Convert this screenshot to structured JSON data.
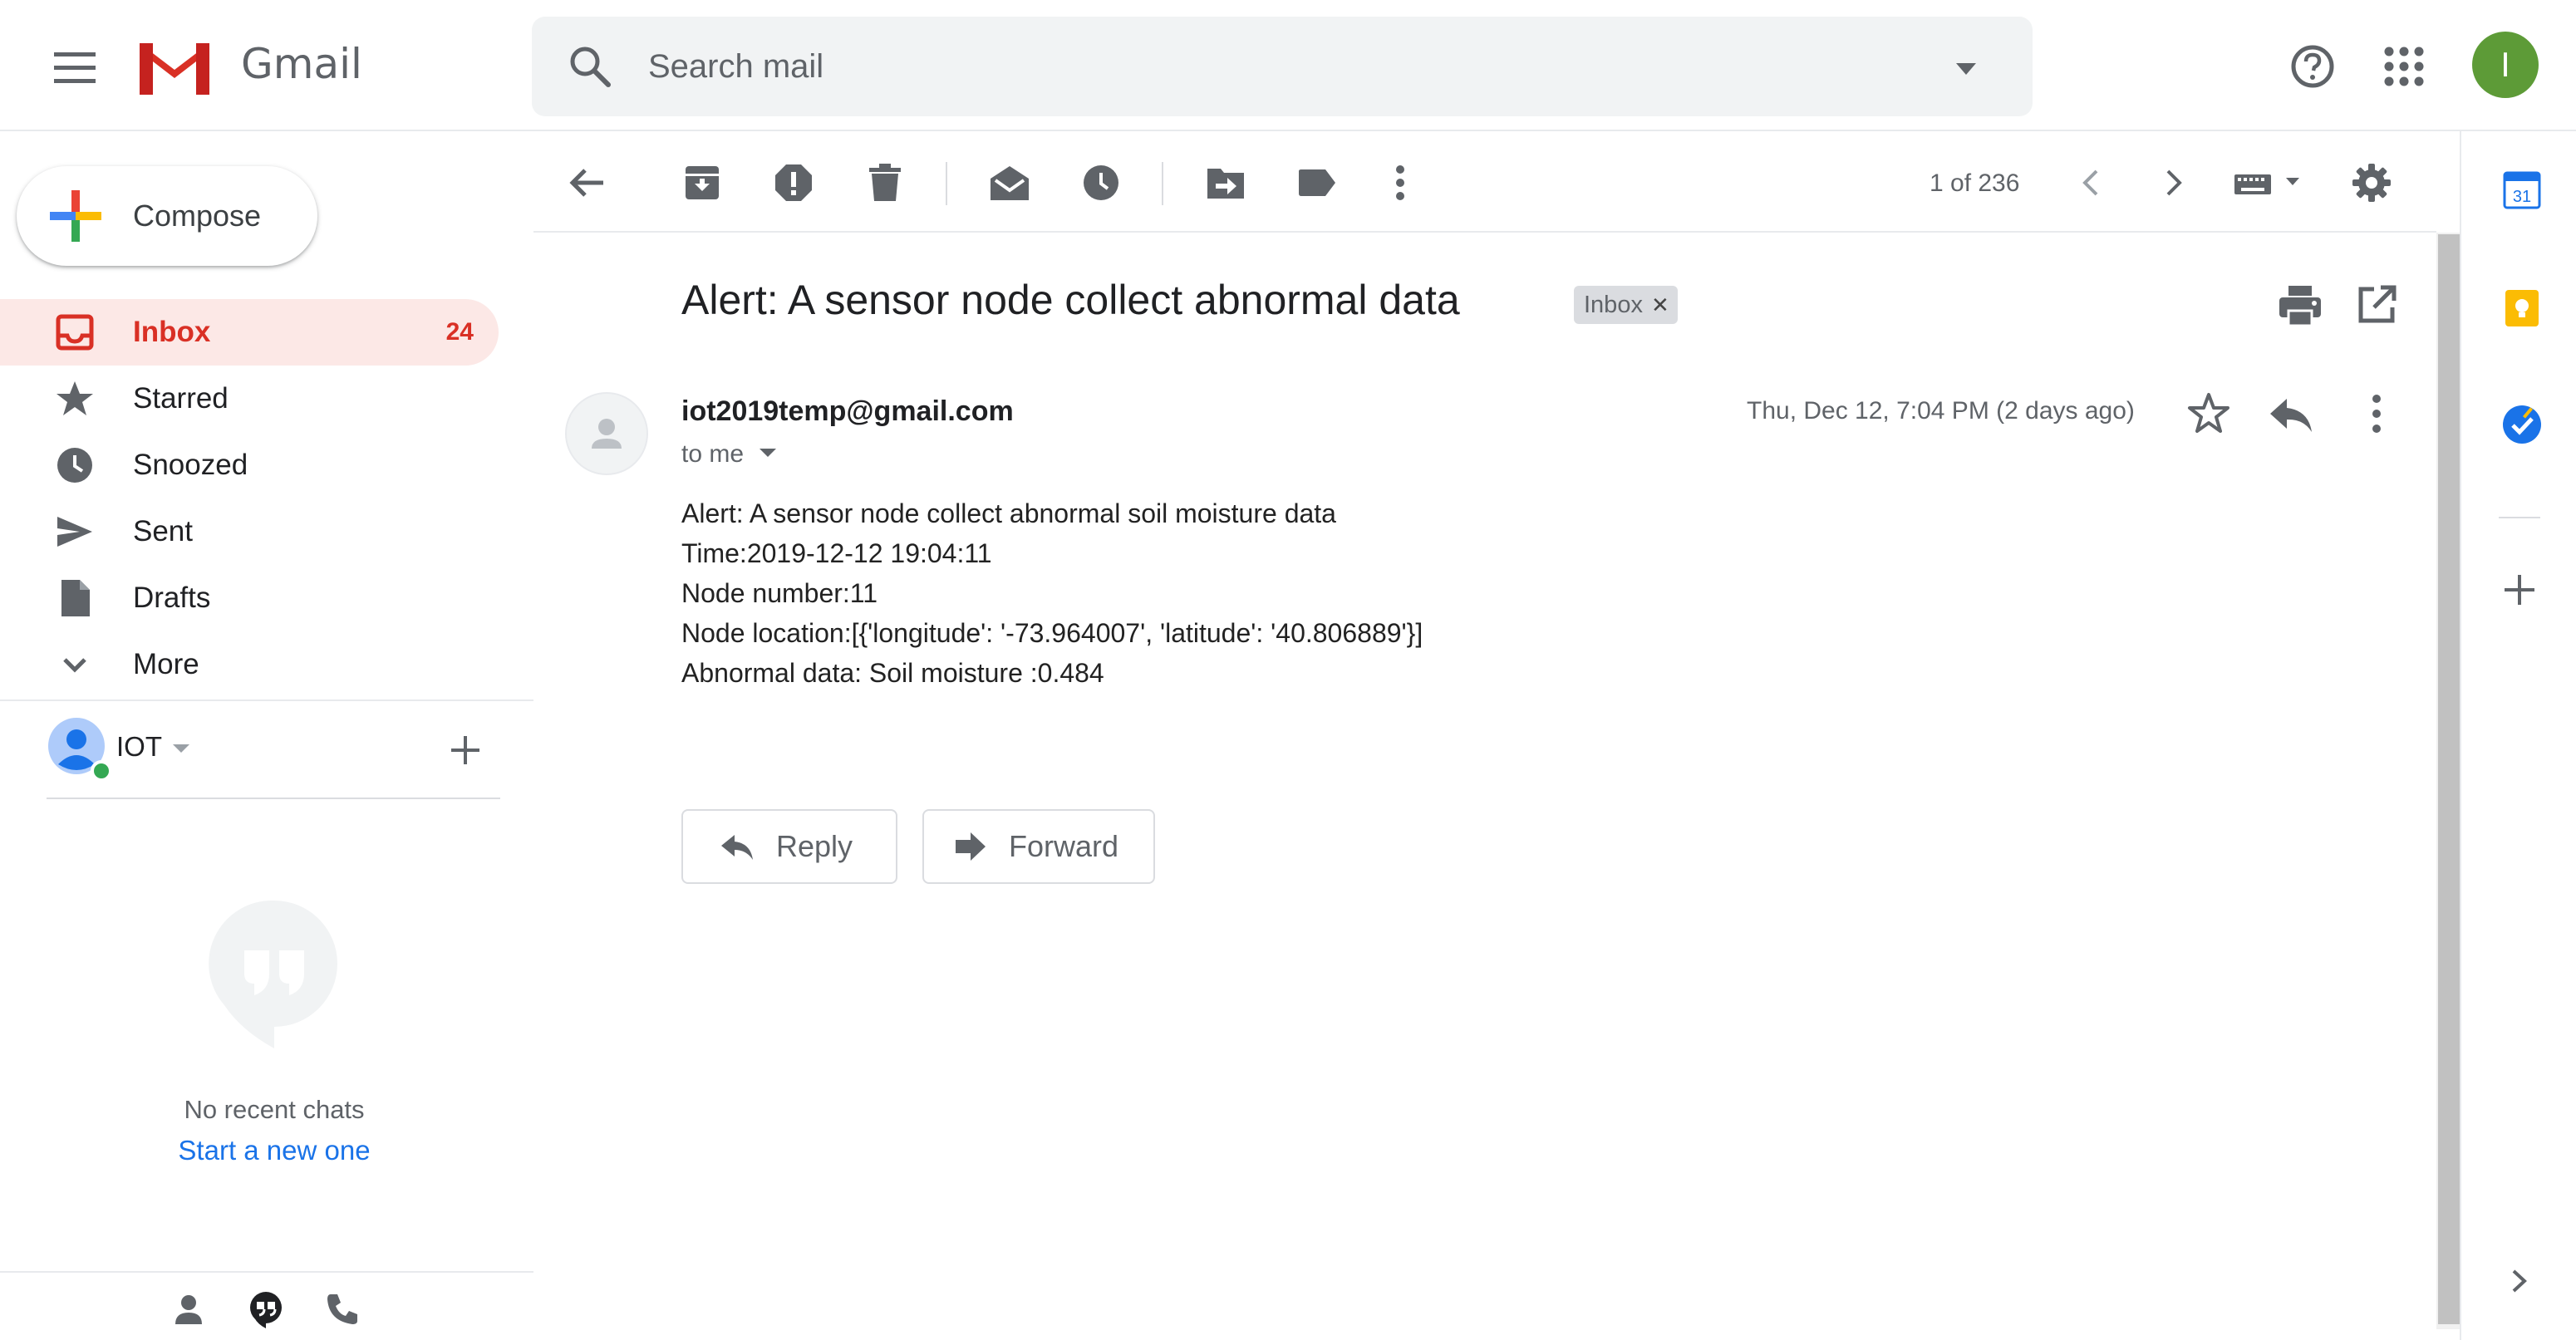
{
  "app": {
    "brand": "Gmail"
  },
  "search": {
    "placeholder": "Search mail"
  },
  "header": {
    "avatar_initial": "I"
  },
  "sidebar": {
    "compose_label": "Compose",
    "items": [
      {
        "label": "Inbox",
        "count": "24",
        "icon": "inbox-icon",
        "active": true
      },
      {
        "label": "Starred",
        "icon": "star-icon"
      },
      {
        "label": "Snoozed",
        "icon": "clock-icon"
      },
      {
        "label": "Sent",
        "icon": "send-icon"
      },
      {
        "label": "Drafts",
        "icon": "draft-icon"
      },
      {
        "label": "More",
        "icon": "chevron-down-icon"
      }
    ],
    "account_name": "IOT",
    "chat_empty": "No recent chats",
    "chat_start": "Start a new one"
  },
  "toolbar": {
    "pager": "1 of 236"
  },
  "message": {
    "subject": "Alert: A sensor node collect abnormal data",
    "label_chip": "Inbox",
    "sender": "iot2019temp@gmail.com",
    "to": "to me",
    "date": "Thu, Dec 12, 7:04 PM (2 days ago)",
    "body": [
      "Alert: A sensor node collect abnormal soil moisture data",
      "Time:2019-12-12 19:04:11",
      "Node number:11",
      "Node location:[{'longitude': '-73.964007', 'latitude': '40.806889'}]",
      "Abnormal data: Soil moisture :0.484"
    ],
    "reply_label": "Reply",
    "forward_label": "Forward"
  },
  "right_panel": {
    "calendar_day": "31"
  },
  "colors": {
    "accent_red": "#d93025",
    "link_blue": "#1a73e8",
    "avatar_green": "#5d9b37",
    "active_bg": "#fce8e6"
  }
}
